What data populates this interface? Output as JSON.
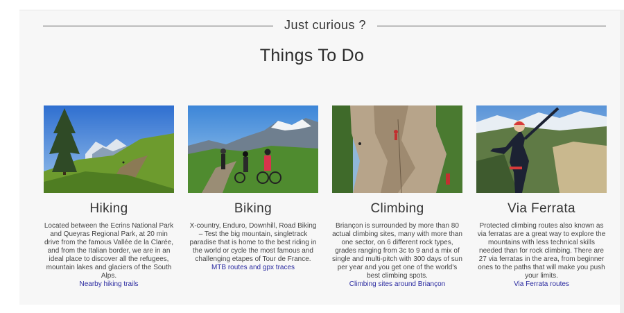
{
  "section": {
    "eyebrow": "Just curious ?",
    "title": "Things To Do"
  },
  "cards": [
    {
      "title": "Hiking",
      "description": "Located between the Ecrins National Park and Queyras Regional Park, at 20 min drive from the famous Vallée de la Clarée, and from the Italian border, we are in an ideal place to discover all the refugees, mountain lakes and glaciers of the South Alps.",
      "link": "Nearby hiking trails",
      "image": "hiking-trail-photo"
    },
    {
      "title": "Biking",
      "description": "X-country, Enduro, Downhill, Road Biking – Test the big mountain, singletrack paradise that is home to the best riding in the world or cycle the most famous and challenging etapes of Tour de France.",
      "link": "MTB routes and gpx traces",
      "image": "mountain-bikers-photo"
    },
    {
      "title": "Climbing",
      "description": "Briançon is surrounded by more than 80 actual climbing sites, many with more than one sector, on 6 different rock types, grades ranging from 3c to 9 and a mix of single and multi-pitch with 300 days of sun per year and you get one of the world's best climbing spots.",
      "link": "Climbing sites around Briançon",
      "image": "rock-climbing-photo"
    },
    {
      "title": "Via Ferrata",
      "description": "Protected climbing routes also known as via ferratas are a great way to explore the mountains with less technical skills needed than for rock climbing. There are 27 via ferratas in the area, from beginner ones to the paths that will make you push your limits.",
      "link": "Via Ferrata routes",
      "image": "via-ferrata-climber-photo"
    }
  ],
  "colors": {
    "link": "#2a2aa0",
    "background": "#f7f7f7",
    "text": "#333333"
  }
}
